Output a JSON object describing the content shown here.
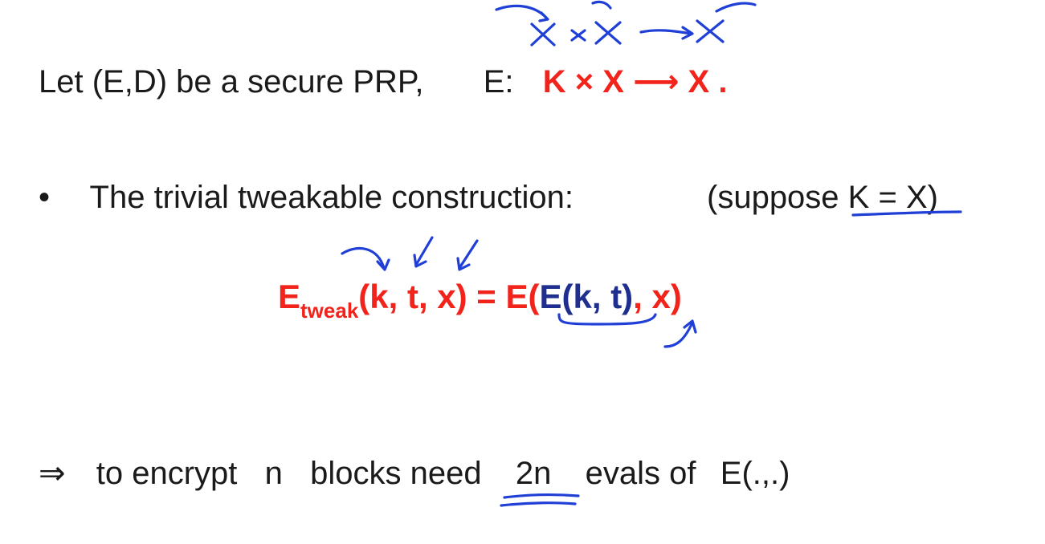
{
  "line1": {
    "text": "Let (E,D) be a secure PRP,",
    "e_label": "E:",
    "signature": "K × X ⟶ X ."
  },
  "line2": {
    "bullet": "•",
    "text": "The trivial tweakable construction:",
    "note_prefix": "(suppose ",
    "note_eq": "K = X",
    "note_suffix": ")"
  },
  "formula": {
    "e": "E",
    "sub": "tweak",
    "args": "(k, t, x) = E(",
    "inner": "E(k, t)",
    "comma": ", ",
    "x": "x",
    "close": ")"
  },
  "line3": {
    "implies": "⇒",
    "p1": "to encrypt",
    "n": "n",
    "p2": "blocks need",
    "twon": "2n",
    "p3": "evals of",
    "func": "E(.,.)"
  },
  "colors": {
    "red": "#f2231b",
    "blue": "#1f2f8f",
    "ink": "#1f3fd6"
  }
}
